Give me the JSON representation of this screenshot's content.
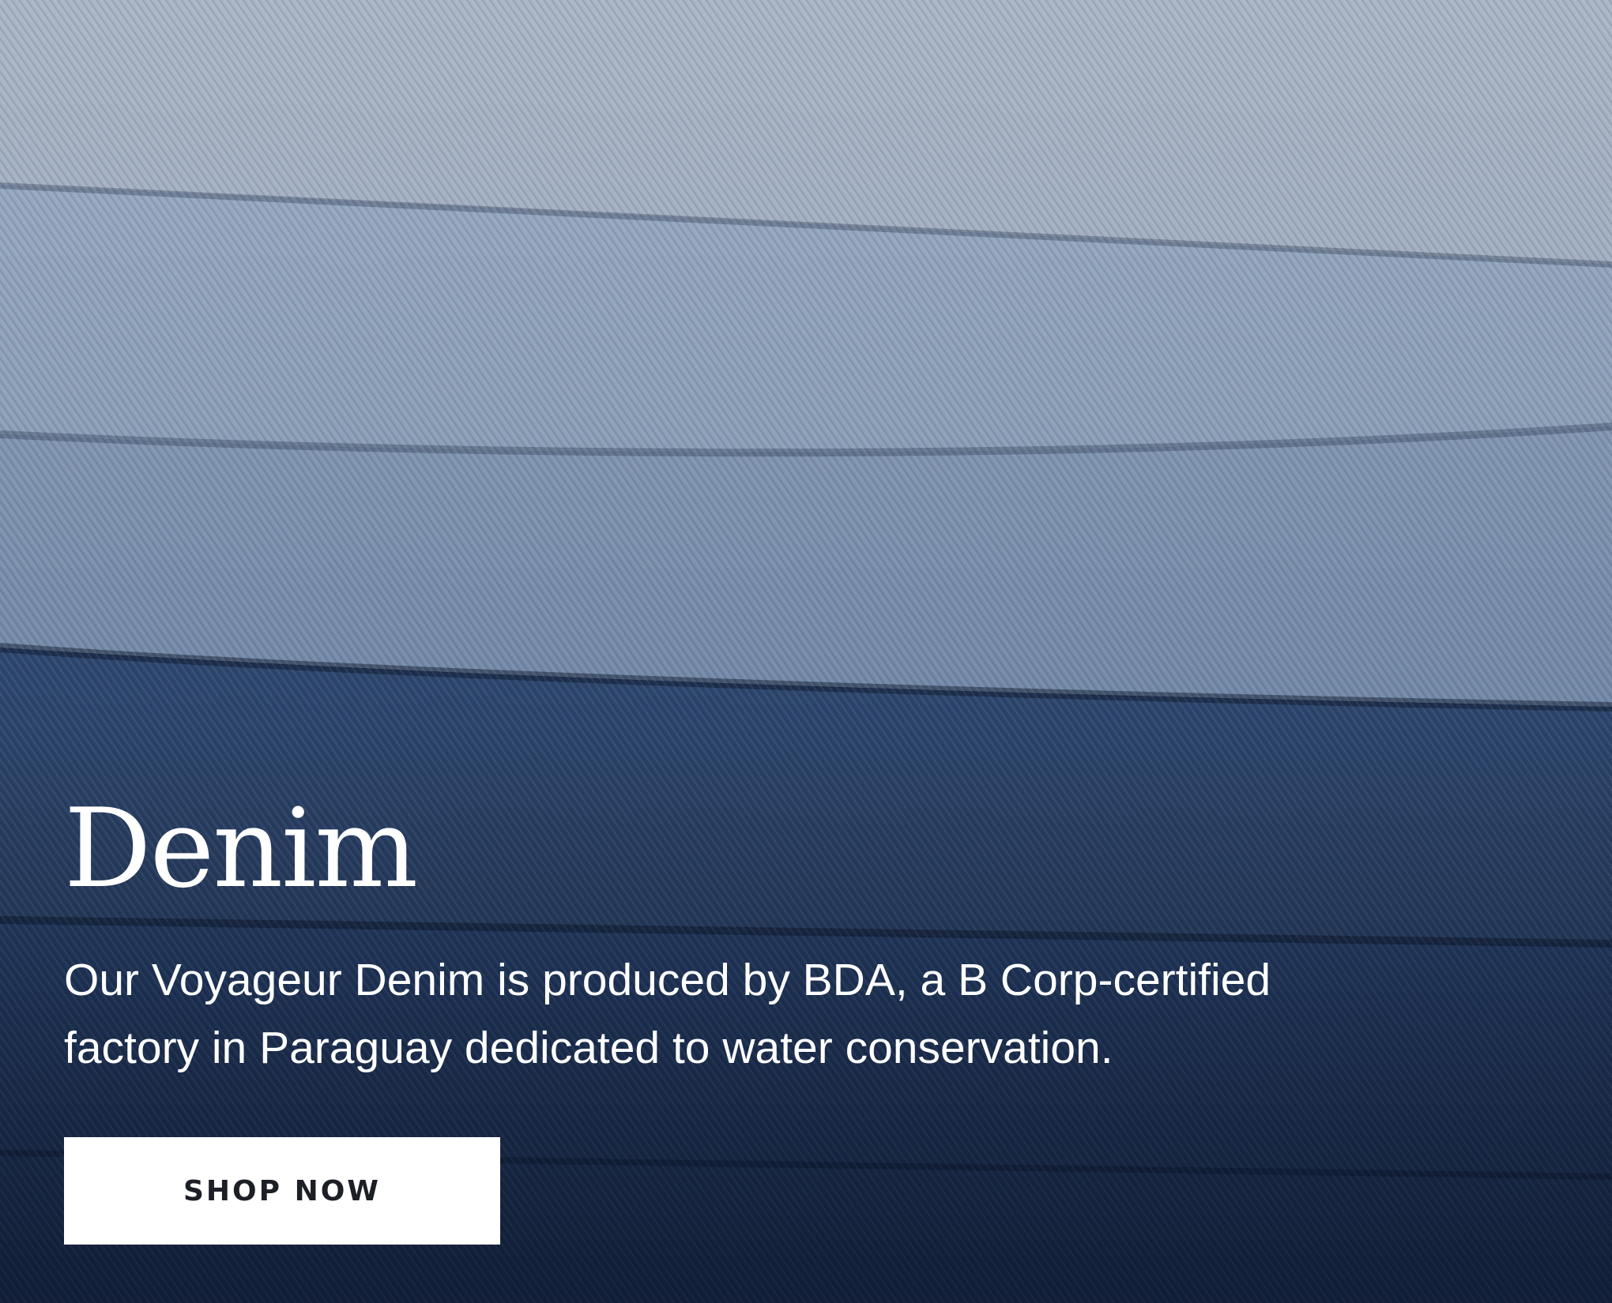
{
  "hero": {
    "title": "Denim",
    "description": "Our Voyageur Denim is produced by BDA, a B Corp-certified factory in Paraguay dedicated to water conservation.",
    "cta_label": "SHOP NOW"
  },
  "colors": {
    "fold_lightest": "#a8b4c6",
    "fold_light": "#8fa2bb",
    "fold_mid": "#7a90ad",
    "fold_dark": "#2c4469",
    "fold_darkest": "#1d2f50",
    "text": "#ffffff",
    "button_bg": "#ffffff",
    "button_text": "#1c1f26"
  }
}
